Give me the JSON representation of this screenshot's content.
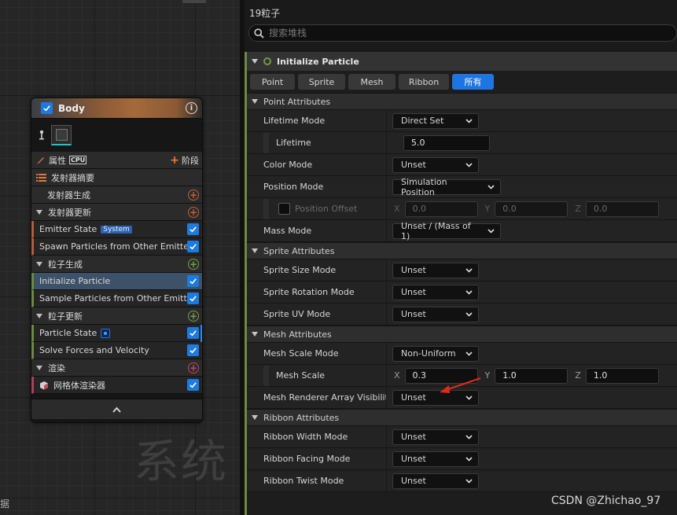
{
  "graph": {
    "watermark": "系统",
    "bottom_label": "据"
  },
  "node": {
    "title": "Body",
    "properties_label": "属性",
    "cpu_label": "CPU",
    "stage_label": "阶段",
    "rows": {
      "emitter_summary": "发射器摘要",
      "emitter_spawn": "发射器生成",
      "emitter_update": "发射器更新",
      "emitter_state": "Emitter State",
      "system_badge": "System",
      "spawn_from_other": "Spawn Particles from Other Emitter",
      "particle_spawn": "粒子生成",
      "initialize_particle": "Initialize Particle",
      "sample_from_other": "Sample Particles from Other Emitter",
      "particle_update": "粒子更新",
      "particle_state": "Particle State",
      "solve_forces": "Solve Forces and Velocity",
      "render": "渲染",
      "mesh_renderer": "网格体渲染器"
    }
  },
  "panel": {
    "particle_count": "19粒子",
    "search_placeholder": "搜索堆栈",
    "module_title": "Initialize Particle",
    "tabs": [
      "Point",
      "Sprite",
      "Mesh",
      "Ribbon",
      "所有"
    ],
    "active_tab": "所有",
    "point_attributes": {
      "title": "Point Attributes",
      "lifetime_mode_label": "Lifetime Mode",
      "lifetime_mode_value": "Direct Set",
      "lifetime_label": "Lifetime",
      "lifetime_value": "5.0",
      "color_mode_label": "Color Mode",
      "color_mode_value": "Unset",
      "position_mode_label": "Position Mode",
      "position_mode_value": "Simulation Position",
      "position_offset_label": "Position Offset",
      "position_offset": {
        "x": "0.0",
        "y": "0.0",
        "z": "0.0"
      },
      "mass_mode_label": "Mass Mode",
      "mass_mode_value": "Unset / (Mass of 1)"
    },
    "sprite_attributes": {
      "title": "Sprite Attributes",
      "size_mode_label": "Sprite Size Mode",
      "size_mode_value": "Unset",
      "rotation_mode_label": "Sprite Rotation Mode",
      "rotation_mode_value": "Unset",
      "uv_mode_label": "Sprite UV Mode",
      "uv_mode_value": "Unset"
    },
    "mesh_attributes": {
      "title": "Mesh Attributes",
      "scale_mode_label": "Mesh Scale Mode",
      "scale_mode_value": "Non-Uniform",
      "scale_label": "Mesh Scale",
      "scale": {
        "x": "0.3",
        "y": "1.0",
        "z": "1.0"
      },
      "renderer_visibility_label": "Mesh Renderer Array Visibility",
      "renderer_visibility_value": "Unset"
    },
    "ribbon_attributes": {
      "title": "Ribbon Attributes",
      "width_mode_label": "Ribbon Width Mode",
      "width_mode_value": "Unset",
      "facing_mode_label": "Ribbon Facing Mode",
      "facing_mode_value": "Unset",
      "twist_mode_label": "Ribbon Twist Mode",
      "twist_mode_value": "Unset"
    },
    "axis_labels": {
      "x": "X",
      "y": "Y",
      "z": "Z"
    }
  },
  "credit": "CSDN @Zhichao_97",
  "colors": {
    "accent_blue": "#1f75e0",
    "module_green": "#6f8a3f",
    "emitter_orange": "#c0603c",
    "particle_green": "#73a04a",
    "render_pink": "#c14463",
    "annotation_red": "#e02a1e"
  }
}
